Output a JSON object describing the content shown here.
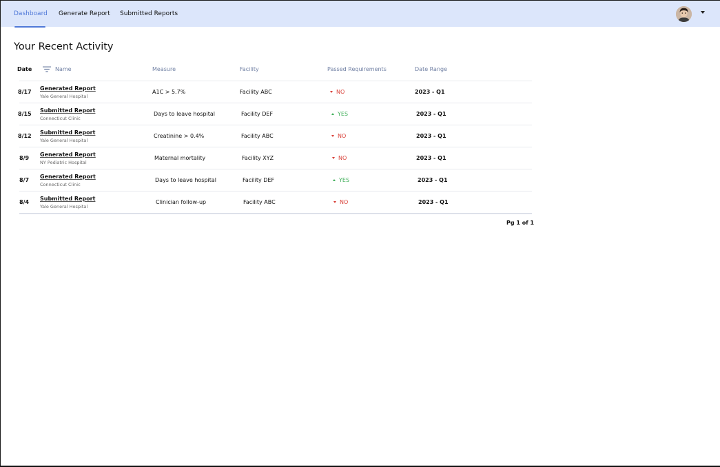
{
  "nav": {
    "tabs": [
      {
        "label": "Dashboard",
        "active": true
      },
      {
        "label": "Generate Report",
        "active": false
      },
      {
        "label": "Submitted Reports",
        "active": false
      }
    ],
    "avatar_icon": "user-avatar",
    "menu_icon": "caret-down-icon"
  },
  "page": {
    "title": "Your Recent Activity"
  },
  "table": {
    "headers": {
      "date": "Date",
      "name": "Name",
      "measure": "Measure",
      "facility": "Facility",
      "passed": "Passed Requirements",
      "range": "Date Range"
    },
    "filter_icon": "filter-icon",
    "rows": [
      {
        "date": "8/17",
        "name": "Generated Report",
        "sub": "Yale General Hospital",
        "measure": "A1C > 5.7%",
        "facility": "Facility ABC",
        "passed": "NO",
        "range": "2023 - Q1"
      },
      {
        "date": "8/15",
        "name": "Submitted Report",
        "sub": "Connecticut Clinic",
        "measure": "Days to leave hospital",
        "facility": "Facility DEF",
        "passed": "YES",
        "range": "2023 - Q1"
      },
      {
        "date": "8/12",
        "name": "Submitted Report",
        "sub": "Yale General Hospital",
        "measure": "Creatinine > 0.4%",
        "facility": "Facility ABC",
        "passed": "NO",
        "range": "2023 - Q1"
      },
      {
        "date": "8/9",
        "name": "Generated Report",
        "sub": "NY Pediatric Hospital",
        "measure": "Maternal mortality",
        "facility": "Facility XYZ",
        "passed": "NO",
        "range": "2023 - Q1"
      },
      {
        "date": "8/7",
        "name": "Generated Report",
        "sub": "Connecticut Clinic",
        "measure": "Days to leave hospital",
        "facility": "Facility DEF",
        "passed": "YES",
        "range": "2023 - Q1"
      },
      {
        "date": "8/4",
        "name": "Submitted Report",
        "sub": "Yale General Hospital",
        "measure": "Clinician follow-up",
        "facility": "Facility ABC",
        "passed": "NO",
        "range": "2023 - Q1"
      }
    ]
  },
  "pager": {
    "label": "Pg 1 of 1"
  },
  "colors": {
    "accent": "#4f78d8",
    "nav_bg": "#dce6fb",
    "fail": "#d9423a",
    "pass": "#43b05c"
  }
}
